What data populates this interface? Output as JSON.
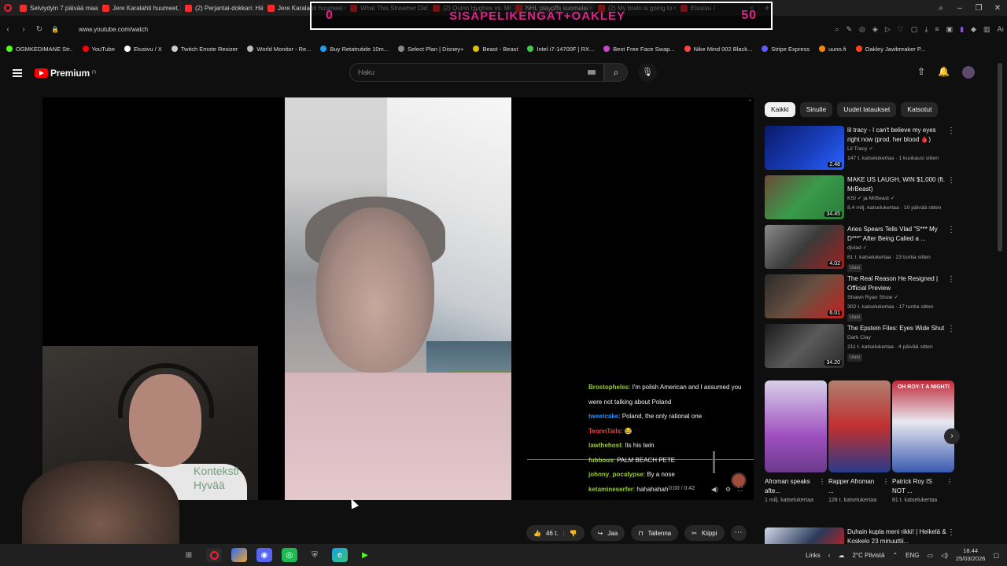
{
  "browser": {
    "tabs": [
      {
        "label": "Selviydyin 7 päivää maalis"
      },
      {
        "label": "Jere Karalahti huumeet, n"
      },
      {
        "label": "(2) Perjantai-dokkari: Häv"
      },
      {
        "label": "Jere Karalahti huumeet"
      },
      {
        "label": "What This Streamer Did"
      },
      {
        "label": "(2) Quinn Hughes vs. Min"
      },
      {
        "label": "NHL playoffs suomalai"
      },
      {
        "label": "(2) My brain is going to"
      },
      {
        "label": "Etusivu /"
      }
    ],
    "url": "www.youtube.com/watch",
    "bookmarks": [
      {
        "label": "OGMKEDIMANE Str..",
        "color": "#53fc18"
      },
      {
        "label": "YouTube",
        "color": "#ff0000"
      },
      {
        "label": "Etusivu / X",
        "color": "#ffffff"
      },
      {
        "label": "Twitch Emote Resizer",
        "color": "#cccccc"
      },
      {
        "label": "World Monitor - Re...",
        "color": "#bbbbbb"
      },
      {
        "label": "Buy Retatrutide 10m...",
        "color": "#1da1f2"
      },
      {
        "label": "Select Plan | Disney+",
        "color": "#888888"
      },
      {
        "label": "Beast - Beast",
        "color": "#e0c000"
      },
      {
        "label": "Intel i7-14700F | RX...",
        "color": "#44cc44"
      },
      {
        "label": "Best Free Face Swap...",
        "color": "#cc44cc"
      },
      {
        "label": "Nike Mind 002 Black...",
        "color": "#ff4444"
      },
      {
        "label": "Stripe Express",
        "color": "#635bff"
      },
      {
        "label": "uuno.fi",
        "color": "#ff8800"
      },
      {
        "label": "Oakley Jawbreaker P...",
        "color": "#ff4422"
      }
    ]
  },
  "overlay": {
    "left_count": "0",
    "text": "SISÄPELIKENGÄT+OAKLEY",
    "right_count": "50"
  },
  "youtube": {
    "logo_label": "Premium",
    "logo_sup": "FI",
    "search_placeholder": "Haku",
    "webcam_caption": "Konteksti Hyvää",
    "chat": [
      {
        "user": "Brostopheles",
        "color": "#9acd32",
        "message": "I'm polish American and I assumed you were not talking about Poland"
      },
      {
        "user": "tweetcake",
        "color": "#1e90ff",
        "message": "Poland, the only rational one"
      },
      {
        "user": "TeonnTails",
        "color": "#ff3b3b",
        "message": "😂"
      },
      {
        "user": "lawthehost",
        "color": "#9acd32",
        "message": "Its his twin"
      },
      {
        "user": "fubbous",
        "color": "#9acd32",
        "message": "PALM BEACH PETE"
      },
      {
        "user": "johnny_pocalypse",
        "color": "#9acd32",
        "message": "By a nose"
      },
      {
        "user": "ketamineserfer",
        "color": "#9acd32",
        "message": "hahahahah"
      }
    ],
    "timecode": "0:00 / 0:42",
    "chips": [
      "Kaikki",
      "Sinulle",
      "Uudet lataukset",
      "Katsotut"
    ],
    "recommendations": [
      {
        "title": "lil tracy - I can't believe my eyes right now (prod. her blood 🩸)",
        "channel": "Lil Tracy ✓",
        "meta": "147 t. katselukertaa · 1 kuukausi sitten",
        "duration": "2.48",
        "badge": "",
        "thumb": "linear-gradient(135deg,#0a1a6a,#1a40c0 60%,#2a64ff)"
      },
      {
        "title": "MAKE US LAUGH, WIN $1,000 (ft. MrBeast)",
        "channel": "KSI ✓ ja MrBeast ✓",
        "meta": "8,4 milj. katselukertaa · 10 päivää sitten",
        "duration": "34.45",
        "badge": "",
        "thumb": "linear-gradient(135deg,#6a4a3a,#3a9a4a 50%,#2a7a3a)"
      },
      {
        "title": "Aries Spears Tells Vlad \"S*** My D***\" After Being Called a ...",
        "channel": "djvlad ✓",
        "meta": "61 t. katselukertaa · 23 tuntia sitten",
        "duration": "4.02",
        "badge": "Uusi",
        "thumb": "linear-gradient(135deg,#8a8a8a,#3a3a3a 50%,#a02020)"
      },
      {
        "title": "The Real Reason He Resigned | Official Preview",
        "channel": "Shawn Ryan Show ✓",
        "meta": "302 t. katselukertaa · 17 tuntia sitten",
        "duration": "6.01",
        "badge": "Uusi",
        "thumb": "linear-gradient(135deg,#2a2a2a,#6a5040 50%,#c02020)"
      },
      {
        "title": "The Epstein Files: Eyes Wide Shut",
        "channel": "Dark Clay",
        "meta": "211 t. katselukertaa · 4 päivää sitten",
        "duration": "34.20",
        "badge": "Uusi",
        "thumb": "linear-gradient(135deg,#1a1a1a,#5a5a5a 50%,#2a2a2a)"
      }
    ],
    "shorts": [
      {
        "title": "Afroman speaks afte...",
        "views": "1 milj. katselukertaa",
        "thumb": "linear-gradient(180deg,#d8d0e8,#a050c0 60%,#6a3a8a)"
      },
      {
        "title": "Rapper Afroman ...",
        "views": "128 t. katselukertaa",
        "thumb": "linear-gradient(180deg,#b08070,#c03030 50%,#2a3a8a)"
      },
      {
        "title": "Patrick Roy IS NOT ...",
        "views": "81 t. katselukertaa",
        "thumb": "linear-gradient(180deg,#c02a3a,#e8e8f0 45%,#3a5ab0)"
      }
    ],
    "shorts_overlay": "OH ROY-T A NIGHT!",
    "last_rec_title": "Duhain kupla meni rikki! | Heikelä & Koskelo 23 minuuttii...",
    "actions": {
      "likes": "46 t.",
      "share": "Jaa",
      "save": "Tallenna",
      "clip": "Kiippi"
    }
  },
  "taskbar": {
    "links_label": "Links",
    "weather": "2°C Pilvistä",
    "lang": "ENG",
    "time": "18.44",
    "date": "25/03/2026"
  }
}
